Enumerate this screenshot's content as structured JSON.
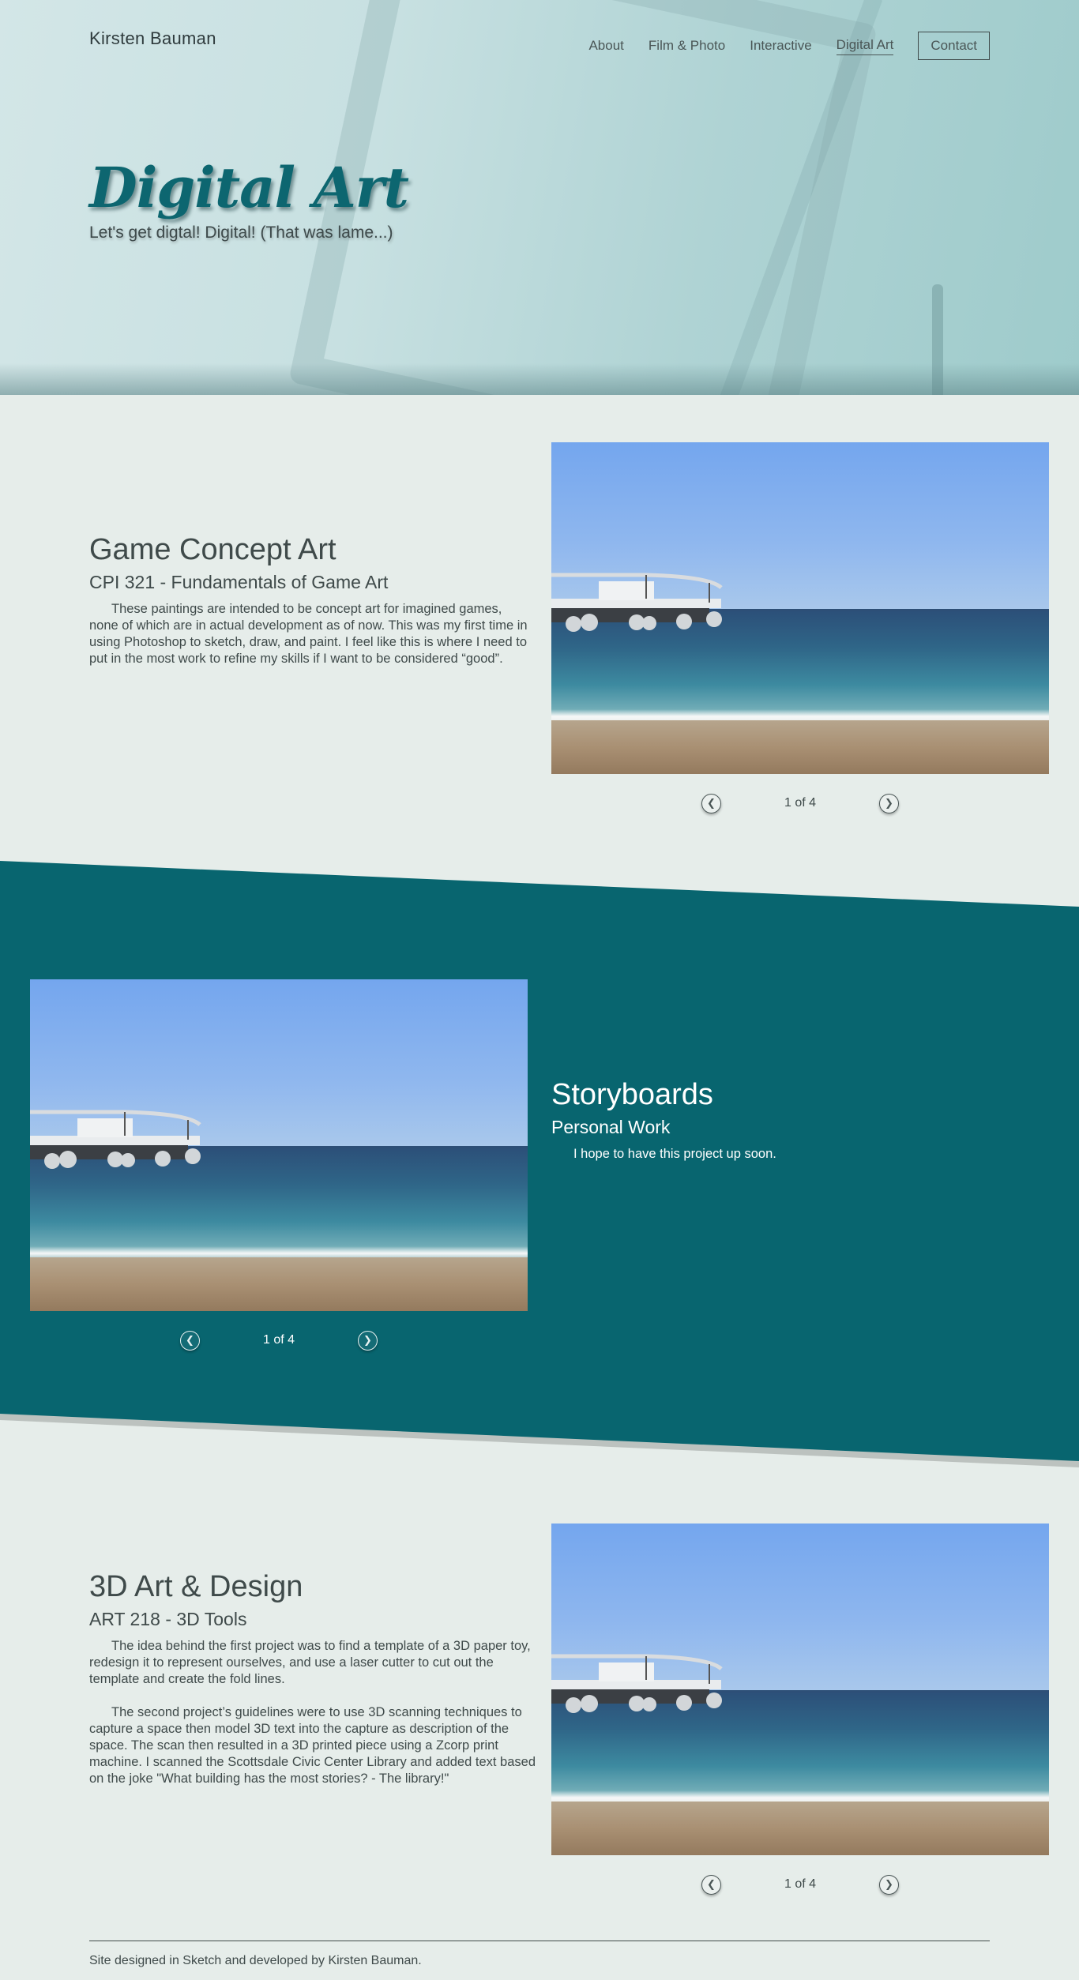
{
  "header": {
    "brand": "Kirsten Bauman",
    "nav": [
      {
        "label": "About"
      },
      {
        "label": "Film & Photo"
      },
      {
        "label": "Interactive"
      },
      {
        "label": "Digital Art",
        "active": true
      },
      {
        "label": "Contact"
      }
    ]
  },
  "hero": {
    "title": "Digital Art",
    "subtitle": "Let's get digtal! Digital! (That was lame...)"
  },
  "sections": [
    {
      "title": "Game Concept Art",
      "subtitle": "CPI 321 - Fundamentals of Game Art",
      "paragraphs": [
        "These paintings are intended to be concept art for imagined games, none of which are in actual development as of now. This was my first time in using Photoshop to sketch, draw, and paint. I feel like this is where I need to put in the most work to refine my skills if I want to be considered “good”."
      ],
      "pager": "1 of 4"
    },
    {
      "title": "Storyboards",
      "subtitle": "Personal Work",
      "paragraphs": [
        "I hope to have this project up soon."
      ],
      "pager": "1 of 4"
    },
    {
      "title": "3D Art & Design",
      "subtitle": "ART 218 - 3D Tools",
      "paragraphs": [
        "The idea behind the first project was to find a template of a 3D paper toy, redesign it to represent ourselves, and use a laser cutter to cut out the template and create the fold lines.",
        "The second project’s guidelines were to use 3D scanning techniques to capture a space then model 3D text into the capture as description of the space. The scan then resulted in a 3D printed piece using a Zcorp print machine. I scanned the Scottsdale Civic Center Library and added text based on the joke \"What building has the most stories? - The library!\""
      ],
      "pager": "1 of 4"
    }
  ],
  "footer": {
    "text": "Site designed in Sketch and developed by Kirsten Bauman."
  },
  "colors": {
    "accent_teal": "#08656f",
    "hero_title": "#0d6670",
    "background": "#e6edea",
    "text": "#3f4a4a"
  },
  "icons": {
    "prev": "chevron-left-circle-icon",
    "next": "chevron-right-circle-icon"
  }
}
